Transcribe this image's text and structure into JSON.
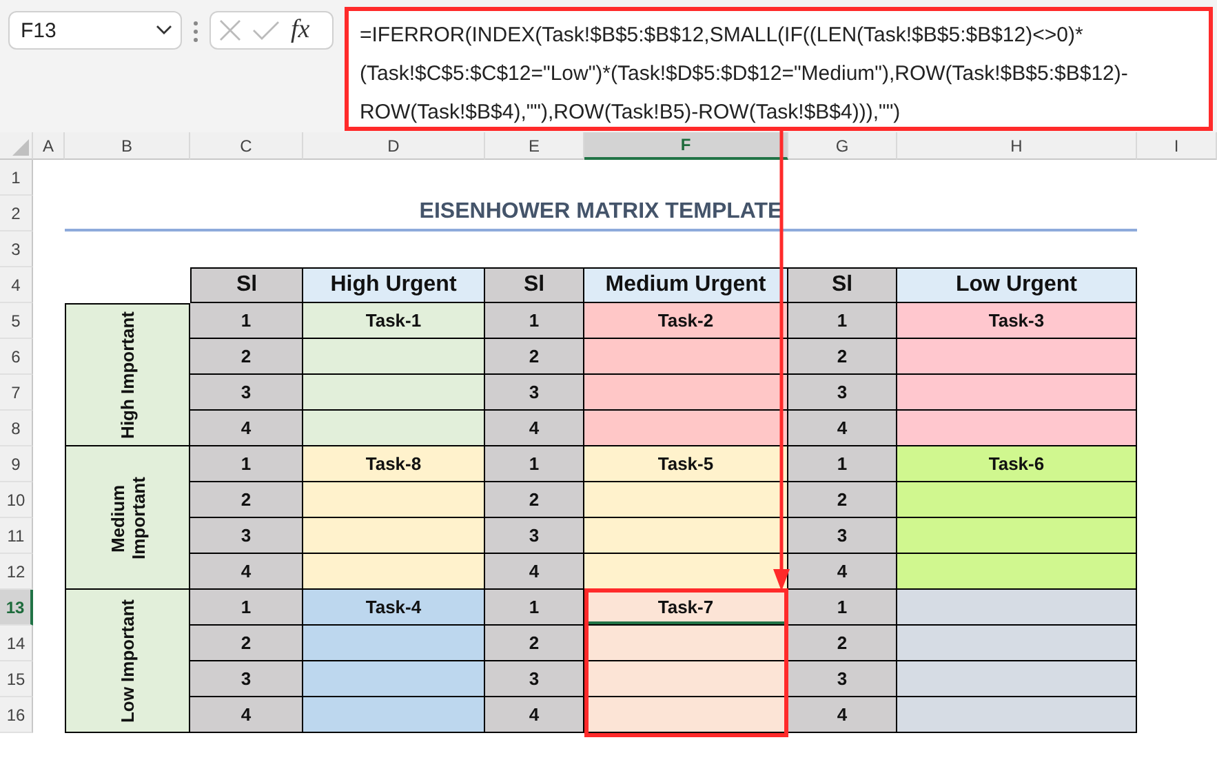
{
  "name_box": {
    "value": "F13"
  },
  "formula_bar": {
    "function_label": "fx",
    "formula": "=IFERROR(INDEX(Task!$B$5:$B$12,SMALL(IF((LEN(Task!$B$5:$B$12)<>0)*(Task!$C$5:$C$12=\"Low\")*(Task!$D$5:$D$12=\"Medium\"),ROW(Task!$B$5:$B$12)-ROW(Task!$B$4),\"\"),ROW(Task!B5)-ROW(Task!$B$4))),\"\")",
    "highlighted": true
  },
  "columns": [
    {
      "label": "A",
      "selected": false
    },
    {
      "label": "B",
      "selected": false
    },
    {
      "label": "C",
      "selected": false
    },
    {
      "label": "D",
      "selected": false
    },
    {
      "label": "E",
      "selected": false
    },
    {
      "label": "F",
      "selected": true
    },
    {
      "label": "G",
      "selected": false
    },
    {
      "label": "H",
      "selected": false
    },
    {
      "label": "I",
      "selected": false
    }
  ],
  "rows": [
    {
      "label": "1",
      "selected": false
    },
    {
      "label": "2",
      "selected": false
    },
    {
      "label": "3",
      "selected": false
    },
    {
      "label": "4",
      "selected": false
    },
    {
      "label": "5",
      "selected": false
    },
    {
      "label": "6",
      "selected": false
    },
    {
      "label": "7",
      "selected": false
    },
    {
      "label": "8",
      "selected": false
    },
    {
      "label": "9",
      "selected": false
    },
    {
      "label": "10",
      "selected": false
    },
    {
      "label": "11",
      "selected": false
    },
    {
      "label": "12",
      "selected": false
    },
    {
      "label": "13",
      "selected": true
    },
    {
      "label": "14",
      "selected": false
    },
    {
      "label": "15",
      "selected": false
    },
    {
      "label": "16",
      "selected": false
    }
  ],
  "sheet": {
    "title": "EISENHOWER MATRIX TEMPLATE",
    "headers": [
      {
        "label": "Sl",
        "kind": "serial"
      },
      {
        "label": "High Urgent",
        "kind": "urgency"
      },
      {
        "label": "Sl",
        "kind": "serial"
      },
      {
        "label": "Medium Urgent",
        "kind": "urgency"
      },
      {
        "label": "Sl",
        "kind": "serial"
      },
      {
        "label": "Low Urgent",
        "kind": "urgency"
      }
    ],
    "groups": [
      {
        "label": "High Important",
        "quadrants": [
          {
            "color": "#e2efda",
            "highlighted": false,
            "rows": [
              {
                "serial": "1",
                "task": "Task-1",
                "selected": false
              },
              {
                "serial": "2",
                "selected": false
              },
              {
                "serial": "3",
                "selected": false
              },
              {
                "serial": "4",
                "selected": false
              }
            ]
          },
          {
            "color": "#ffc7c7",
            "highlighted": false,
            "rows": [
              {
                "serial": "1",
                "task": "Task-2",
                "selected": false
              },
              {
                "serial": "2",
                "selected": false
              },
              {
                "serial": "3",
                "selected": false
              },
              {
                "serial": "4",
                "selected": false
              }
            ]
          },
          {
            "color": "#ffc7ce",
            "highlighted": false,
            "rows": [
              {
                "serial": "1",
                "task": "Task-3",
                "selected": false
              },
              {
                "serial": "2",
                "selected": false
              },
              {
                "serial": "3",
                "selected": false
              },
              {
                "serial": "4",
                "selected": false
              }
            ]
          }
        ]
      },
      {
        "label": "Medium Important",
        "quadrants": [
          {
            "color": "#fff2cc",
            "highlighted": false,
            "rows": [
              {
                "serial": "1",
                "task": "Task-8",
                "selected": false
              },
              {
                "serial": "2",
                "selected": false
              },
              {
                "serial": "3",
                "selected": false
              },
              {
                "serial": "4",
                "selected": false
              }
            ]
          },
          {
            "color": "#fff2cc",
            "highlighted": false,
            "rows": [
              {
                "serial": "1",
                "task": "Task-5",
                "selected": false
              },
              {
                "serial": "2",
                "selected": false
              },
              {
                "serial": "3",
                "selected": false
              },
              {
                "serial": "4",
                "selected": false
              }
            ]
          },
          {
            "color": "#d0f78f",
            "highlighted": false,
            "rows": [
              {
                "serial": "1",
                "task": "Task-6",
                "selected": false
              },
              {
                "serial": "2",
                "selected": false
              },
              {
                "serial": "3",
                "selected": false
              },
              {
                "serial": "4",
                "selected": false
              }
            ]
          }
        ]
      },
      {
        "label": "Low Important",
        "quadrants": [
          {
            "color": "#bdd7ee",
            "highlighted": false,
            "rows": [
              {
                "serial": "1",
                "task": "Task-4",
                "selected": false
              },
              {
                "serial": "2",
                "selected": false
              },
              {
                "serial": "3",
                "selected": false
              },
              {
                "serial": "4",
                "selected": false
              }
            ]
          },
          {
            "color": "#fce4d6",
            "highlighted": true,
            "rows": [
              {
                "serial": "1",
                "task": "Task-7",
                "selected": true
              },
              {
                "serial": "2",
                "selected": false
              },
              {
                "serial": "3",
                "selected": false
              },
              {
                "serial": "4",
                "selected": false
              }
            ]
          },
          {
            "color": "#d6dce4",
            "highlighted": false,
            "rows": [
              {
                "serial": "1",
                "selected": false
              },
              {
                "serial": "2",
                "selected": false
              },
              {
                "serial": "3",
                "selected": false
              },
              {
                "serial": "4",
                "selected": false
              }
            ]
          }
        ]
      }
    ]
  }
}
